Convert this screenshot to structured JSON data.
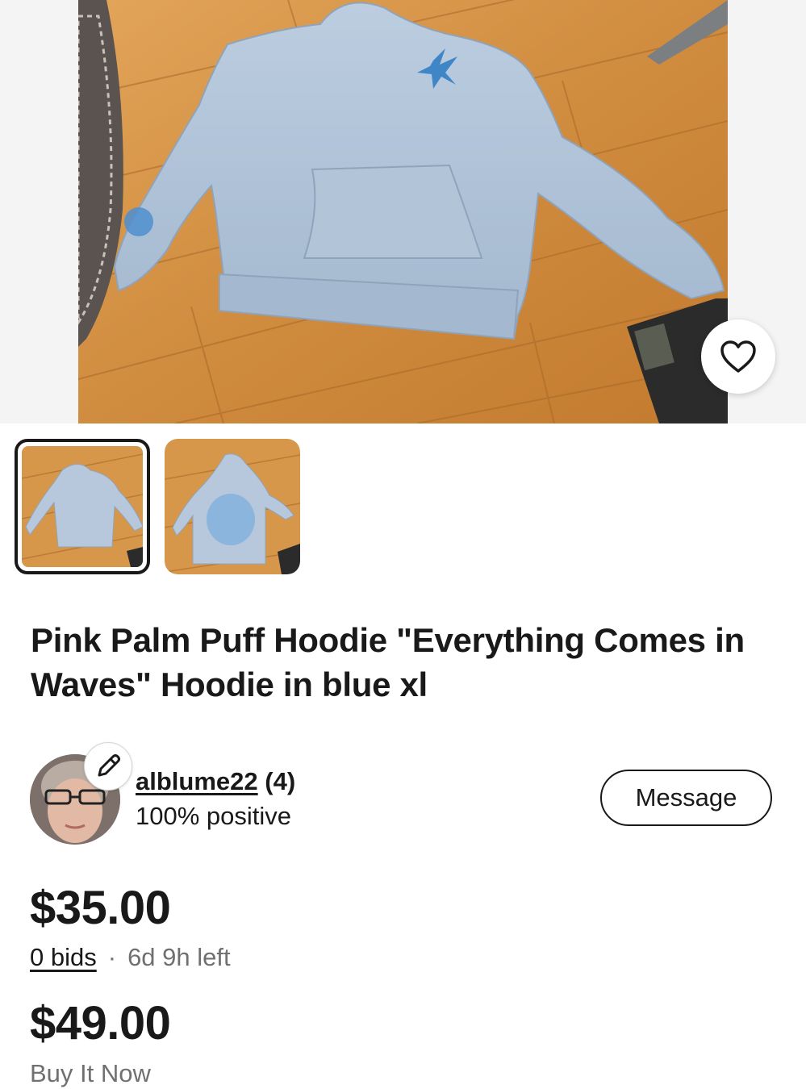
{
  "listing": {
    "title": "Pink Palm Puff Hoodie \"Everything Comes in Waves\" Hoodie in blue xl",
    "images": [
      {
        "name": "hoodie-front",
        "selected": true
      },
      {
        "name": "hoodie-back",
        "selected": false
      }
    ],
    "watch_icon": "heart-icon"
  },
  "seller": {
    "username": "alblume22",
    "feedback_count": "(4)",
    "positive": "100% positive",
    "edit_icon": "pencil-icon",
    "message_label": "Message"
  },
  "auction": {
    "current_price": "$35.00",
    "bids": "0 bids",
    "separator": "·",
    "time_left": "6d 9h left"
  },
  "buy_it_now": {
    "price": "$49.00",
    "label": "Buy It Now"
  },
  "colors": {
    "text": "#191919",
    "secondary_text": "#707070",
    "hoodie_blue": "#a9bfd6",
    "floor_wood": "#d79a4e"
  }
}
